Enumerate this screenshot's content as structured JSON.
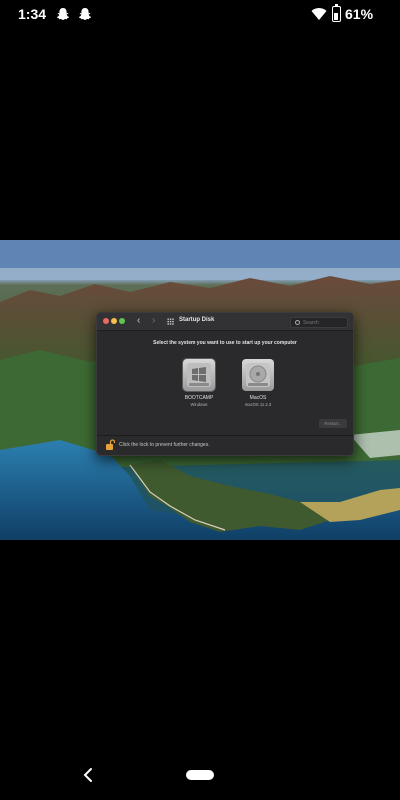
{
  "status_bar": {
    "time": "1:34",
    "battery": "61%",
    "battery_level": 0.61,
    "notification_icons": [
      "snapchat-ghost-icon",
      "snapchat-ghost-icon"
    ],
    "signal_icons": [
      "wifi-icon",
      "battery-icon"
    ]
  },
  "mac_window": {
    "title": "Startup Disk",
    "search_placeholder": "Search",
    "nav_back": "‹",
    "nav_forward": "›",
    "prompt": "Select the system you want to use to start up your computer",
    "disks": [
      {
        "label": "BOOTCAMP",
        "sub": "Windows",
        "selected": true
      },
      {
        "label": "MacOS",
        "sub": "macOS 11.2.3",
        "selected": false
      }
    ],
    "restart_label": "Restart...",
    "lock_text": "Click the lock to prevent further changes."
  },
  "nav_bar": {
    "back_icon": "chevron-left-icon",
    "home_icon": "home-pill"
  },
  "colors": {
    "window_bg": "#2a2a2c",
    "close": "#ee6a5e",
    "minimize": "#f5bf4f",
    "zoom": "#61c554",
    "lock": "#e8a23c"
  }
}
